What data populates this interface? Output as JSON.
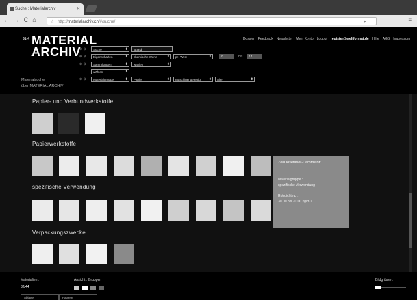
{
  "browser": {
    "tab_title": "Suche : Materialarchiv",
    "url_scheme": "http://",
    "url_host": "materialarchiv.ch",
    "url_path": "/#/suche/"
  },
  "site": {
    "logo_small": "51-4",
    "logo_line1": "MATERIAL",
    "logo_line2": "ARCHIV",
    "sub_dot": "–",
    "sub_line1": "Materialsuche",
    "sub_line2": "über MATERIAL ARCHIV",
    "nav": [
      "Dossier",
      "Feedback",
      "Newsletter",
      "Mein Konto",
      "Logout"
    ],
    "user": "register@weltformat.de",
    "nav_right": [
      "Hilfe",
      "AGB",
      "Impressum"
    ]
  },
  "filters": {
    "row1": {
      "pm": "⊕ ⊖",
      "field": "Suche",
      "value": "Brand|"
    },
    "row2": {
      "pm": "⊕ ⊖",
      "field": "Eigenschaften",
      "prop": "chemische Werte",
      "sub": "pH-Wert",
      "min": "0",
      "bis": "bis",
      "max": "14"
    },
    "row3": {
      "pm": "⊕ ⊖",
      "field": "Sammlungen",
      "value": "wählen"
    },
    "row4": {
      "pm": "",
      "field": "wählen"
    },
    "row5": {
      "pm": "⊕ ⊖",
      "field": "Materialgruppe",
      "group": "Papier",
      "sub": "maschinengefertigt",
      "extra": "Alle"
    }
  },
  "sections": [
    {
      "title": "Papier- und Verbundwerkstoffe"
    },
    {
      "title": "Papierwerkstoffe"
    },
    {
      "title": "spezifische Verwendung"
    },
    {
      "title": "Verpackungszwecke"
    }
  ],
  "tooltip": {
    "title": "Zellulosefaser-Dämmstoff",
    "group_label": "Materialgruppe :",
    "group_value": "spezifische Verwendung",
    "density_label": "Rohdichte ρ :",
    "density_value": "30.00 bis 70.00 kg/m ³"
  },
  "bottom": {
    "materials_label": "Materialien :",
    "materials_value": "32/44",
    "view_label": "Ansicht : Gruppen",
    "size_label": "Bildgrösse :",
    "tabs": [
      "Ablage",
      "Papiere"
    ]
  }
}
